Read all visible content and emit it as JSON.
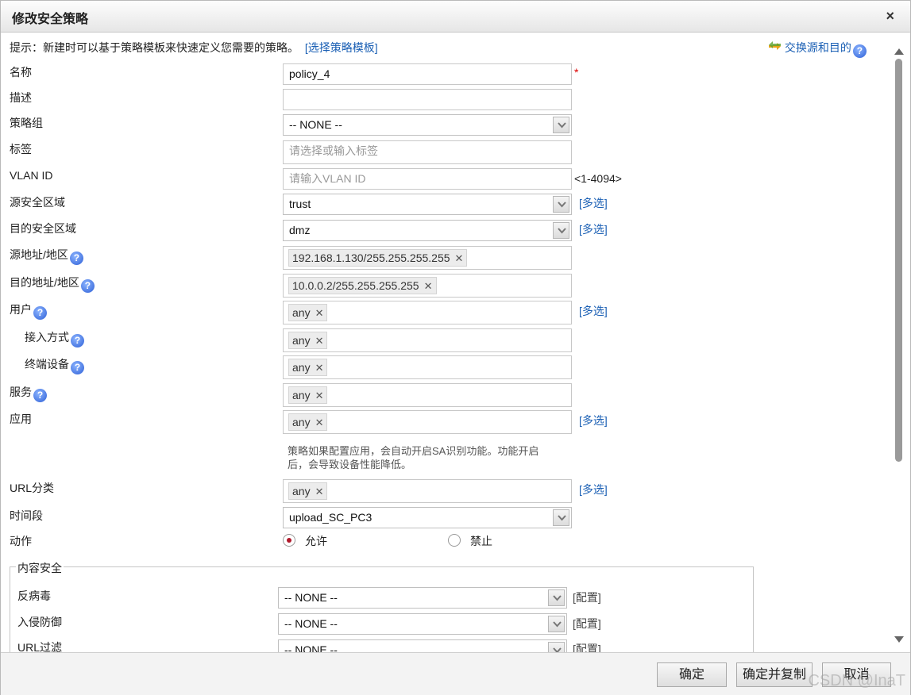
{
  "dialog": {
    "title": "修改安全策略",
    "close_label": "×"
  },
  "hint": {
    "text": "提示：新建时可以基于策略模板来快速定义您需要的策略。",
    "link": "[选择策略模板]",
    "swap_link": "交换源和目的"
  },
  "help_glyph": "?",
  "required_mark": "*",
  "fields": {
    "name": {
      "label": "名称",
      "value": "policy_4"
    },
    "description": {
      "label": "描述",
      "value": ""
    },
    "policy_group": {
      "label": "策略组",
      "value": "-- NONE --"
    },
    "tag": {
      "label": "标签",
      "placeholder": "请选择或输入标签"
    },
    "vlan_id": {
      "label": "VLAN ID",
      "placeholder": "请输入VLAN ID",
      "range": "<1-4094>"
    },
    "src_zone": {
      "label": "源安全区域",
      "value": "trust",
      "multi": "[多选]"
    },
    "dst_zone": {
      "label": "目的安全区域",
      "value": "dmz",
      "multi": "[多选]"
    },
    "src_addr": {
      "label": "源地址/地区",
      "tag": "192.168.1.130/255.255.255.255"
    },
    "dst_addr": {
      "label": "目的地址/地区",
      "tag": "10.0.0.2/255.255.255.255"
    },
    "user": {
      "label": "用户",
      "tag": "any",
      "multi": "[多选]"
    },
    "access_mode": {
      "label": "接入方式",
      "tag": "any"
    },
    "terminal": {
      "label": "终端设备",
      "tag": "any"
    },
    "service": {
      "label": "服务",
      "tag": "any"
    },
    "application": {
      "label": "应用",
      "tag": "any",
      "multi": "[多选]",
      "note_line1": "策略如果配置应用，会自动开启SA识别功能。功能开启",
      "note_line2": "后，会导致设备性能降低。"
    },
    "url_category": {
      "label": "URL分类",
      "tag": "any",
      "multi": "[多选]"
    },
    "schedule": {
      "label": "时间段",
      "value": "upload_SC_PC3"
    },
    "action": {
      "label": "动作",
      "allow": "允许",
      "deny": "禁止",
      "selected": "允许"
    }
  },
  "content_security": {
    "legend": "内容安全",
    "antivirus": {
      "label": "反病毒",
      "value": "-- NONE --",
      "config": "[配置]"
    },
    "ips": {
      "label": "入侵防御",
      "value": "-- NONE --",
      "config": "[配置]"
    },
    "url_filter": {
      "label": "URL过滤",
      "value": "-- NONE --",
      "config": "[配置]"
    }
  },
  "footer": {
    "ok": "确定",
    "ok_copy": "确定并复制",
    "cancel": "取消",
    "watermark": "CSDN @InaT"
  }
}
